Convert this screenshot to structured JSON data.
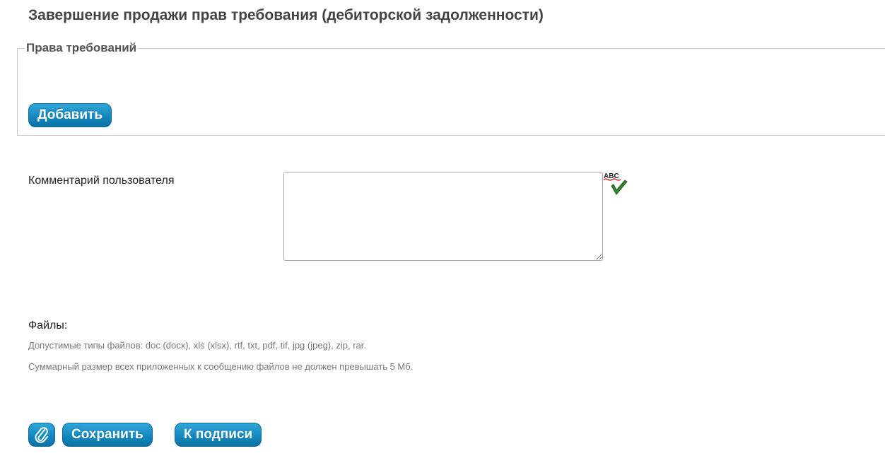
{
  "page": {
    "title": "Завершение продажи прав требования (дебиторской задолженности)"
  },
  "claims": {
    "legend": "Права требований",
    "add_label": "Добавить"
  },
  "comment": {
    "label": "Комментарий пользователя",
    "value": "",
    "spellcheck_icon": "abc-spellcheck-icon"
  },
  "files": {
    "label": "Файлы:",
    "types_note": "Допустимые типы файлов: doc (docx), xls (xlsx), rtf, txt, pdf, tif, jpg (jpeg), zip, rar.",
    "size_note": "Суммарный размер всех приложенных к сообщению файлов не должен превышать 5 Мб."
  },
  "actions": {
    "attach_icon": "paperclip-icon",
    "save_label": "Сохранить",
    "sign_label": "К подписи"
  },
  "colors": {
    "button": "#1489c0",
    "spell_check": "#2e8b2e",
    "spell_text": "#c00000"
  }
}
